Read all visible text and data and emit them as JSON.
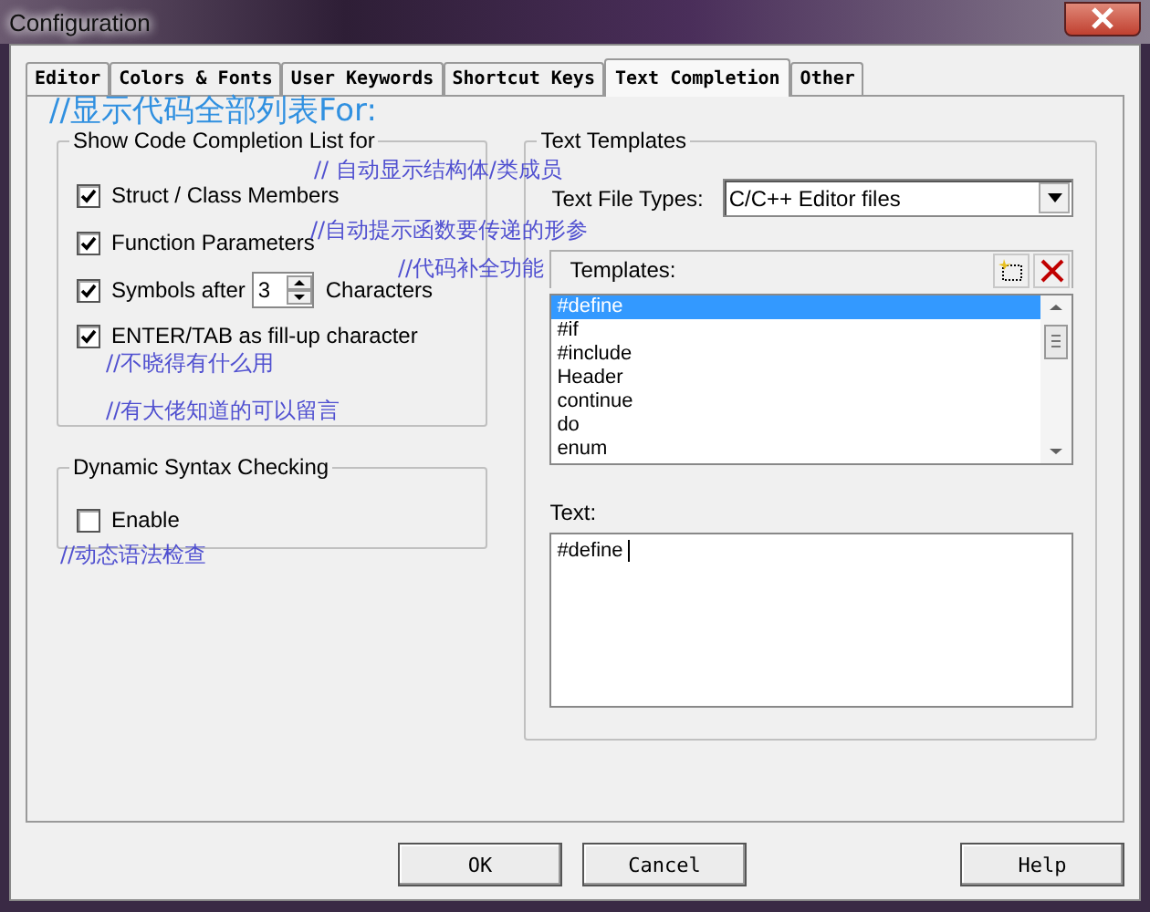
{
  "window": {
    "title": "Configuration"
  },
  "tabs": [
    {
      "label": "Editor",
      "selected": false
    },
    {
      "label": "Colors & Fonts",
      "selected": false
    },
    {
      "label": "User Keywords",
      "selected": false
    },
    {
      "label": "Shortcut Keys",
      "selected": false
    },
    {
      "label": "Text Completion",
      "selected": true
    },
    {
      "label": "Other",
      "selected": false
    }
  ],
  "completion_group": {
    "title": "Show Code Completion List for",
    "options": [
      {
        "kind": "check",
        "label": "Struct / Class Members",
        "checked": true
      },
      {
        "kind": "check",
        "label": "Function Parameters",
        "checked": true
      },
      {
        "kind": "spin",
        "label": "Symbols after",
        "checked": true,
        "value": "3",
        "suffix": "Characters"
      },
      {
        "kind": "check",
        "label": "ENTER/TAB as fill-up character",
        "checked": true
      }
    ]
  },
  "syntax_group": {
    "title": "Dynamic Syntax Checking",
    "options": [
      {
        "kind": "check",
        "label": "Enable",
        "checked": false
      }
    ]
  },
  "templates_group": {
    "title": "Text Templates",
    "file_types_label": "Text File Types:",
    "file_types_value": "C/C++ Editor files",
    "templates_label": "Templates:",
    "templates": [
      {
        "label": "#define",
        "selected": true
      },
      {
        "label": "#if",
        "selected": false
      },
      {
        "label": "#include",
        "selected": false
      },
      {
        "label": "Header",
        "selected": false
      },
      {
        "label": "continue",
        "selected": false
      },
      {
        "label": "do",
        "selected": false
      },
      {
        "label": "enum",
        "selected": false
      }
    ],
    "text_label": "Text:",
    "text_value": "#define "
  },
  "buttons": [
    "OK",
    "Cancel",
    "Help"
  ],
  "annotations": [
    {
      "kind": "heading",
      "text": "//显示代码全部列表For:"
    },
    {
      "kind": "note",
      "text": "// 自动显示结构体/类成员"
    },
    {
      "kind": "note",
      "text": "//自动提示函数要传递的形参"
    },
    {
      "kind": "note",
      "text": "//代码补全功能"
    },
    {
      "kind": "note",
      "text": "//不晓得有什么用"
    },
    {
      "kind": "note",
      "text": "//有大佬知道的可以留言"
    },
    {
      "kind": "note",
      "text": "//动态语法检查"
    }
  ]
}
